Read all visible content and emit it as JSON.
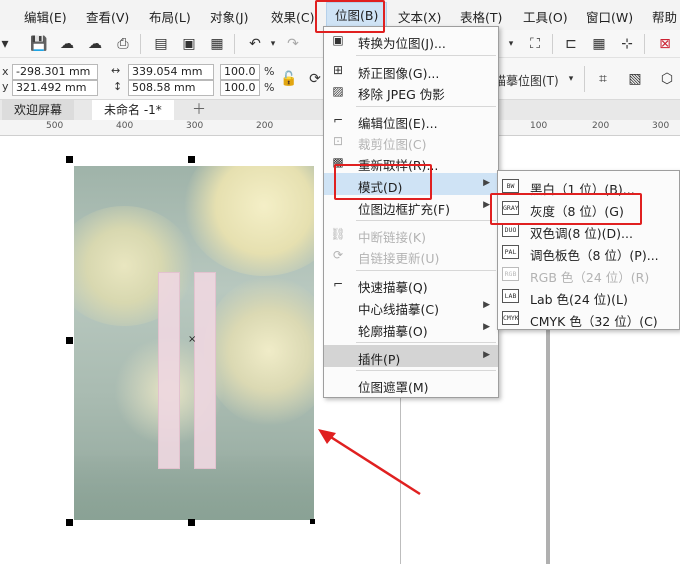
{
  "menubar": {
    "items": [
      "编辑(E)",
      "查看(V)",
      "布局(L)",
      "对象(J)",
      "效果(C)",
      "位图(B)",
      "文本(X)",
      "表格(T)",
      "工具(O)",
      "窗口(W)",
      "帮助"
    ]
  },
  "toolbar2": {
    "x_value": "-298.301 mm",
    "y_value": "321.492 mm",
    "w_value": "339.054 mm",
    "h_value": "508.58 mm",
    "scale_x": "100.0",
    "scale_y": "100.0",
    "percent": "%",
    "trace_label": "描摹位图(T)"
  },
  "tabs": [
    "欢迎屏幕",
    "未命名 -1*"
  ],
  "ruler": [
    "500",
    "400",
    "300",
    "200",
    "100",
    "0",
    "100",
    "200",
    "300"
  ],
  "bitmap_menu": {
    "items": [
      {
        "label": "转换为位图(J)...",
        "icon": "convert-bitmap-icon"
      },
      {
        "label": "矫正图像(G)...",
        "icon": "straighten-icon"
      },
      {
        "label": "移除 JPEG 伪影",
        "icon": "jpeg-icon"
      },
      {
        "label": "编辑位图(E)...",
        "icon": "edit-bitmap-icon"
      },
      {
        "label": "裁剪位图(C)",
        "icon": "crop-bitmap-icon"
      },
      {
        "label": "重新取样(R)...",
        "icon": "resample-icon"
      },
      {
        "label": "模式(D)",
        "icon": "mode-icon"
      },
      {
        "label": "位图边框扩充(F)",
        "icon": "border-icon"
      },
      {
        "label": "中断链接(K)",
        "icon": "break-link-icon"
      },
      {
        "label": "自链接更新(U)",
        "icon": "update-link-icon"
      },
      {
        "label": "快速描摹(Q)",
        "icon": "quick-trace-icon"
      },
      {
        "label": "中心线描摹(C)",
        "icon": "centerline-icon"
      },
      {
        "label": "轮廓描摹(O)",
        "icon": "outline-trace-icon"
      },
      {
        "label": "插件(P)",
        "icon": "plugin-icon"
      },
      {
        "label": "位图遮罩(M)",
        "icon": "mask-icon"
      }
    ]
  },
  "mode_submenu": {
    "items": [
      {
        "icon_text": "BW",
        "label": "黑白（1 位）(B)..."
      },
      {
        "icon_text": "GRAY",
        "label": "灰度（8 位）(G)"
      },
      {
        "icon_text": "DUO",
        "label": "双色调(8 位)(D)..."
      },
      {
        "icon_text": "PAL",
        "label": "调色板色（8 位）(P)..."
      },
      {
        "icon_text": "RGB",
        "label": "RGB 色（24 位）(R)"
      },
      {
        "icon_text": "LAB",
        "label": "Lab 色(24 位)(L)"
      },
      {
        "icon_text": "CMYK",
        "label": "CMYK 色（32 位）(C)"
      }
    ]
  },
  "colors": {
    "accent_highlight": "#cfe3f5",
    "annotation_red": "#e02020"
  }
}
